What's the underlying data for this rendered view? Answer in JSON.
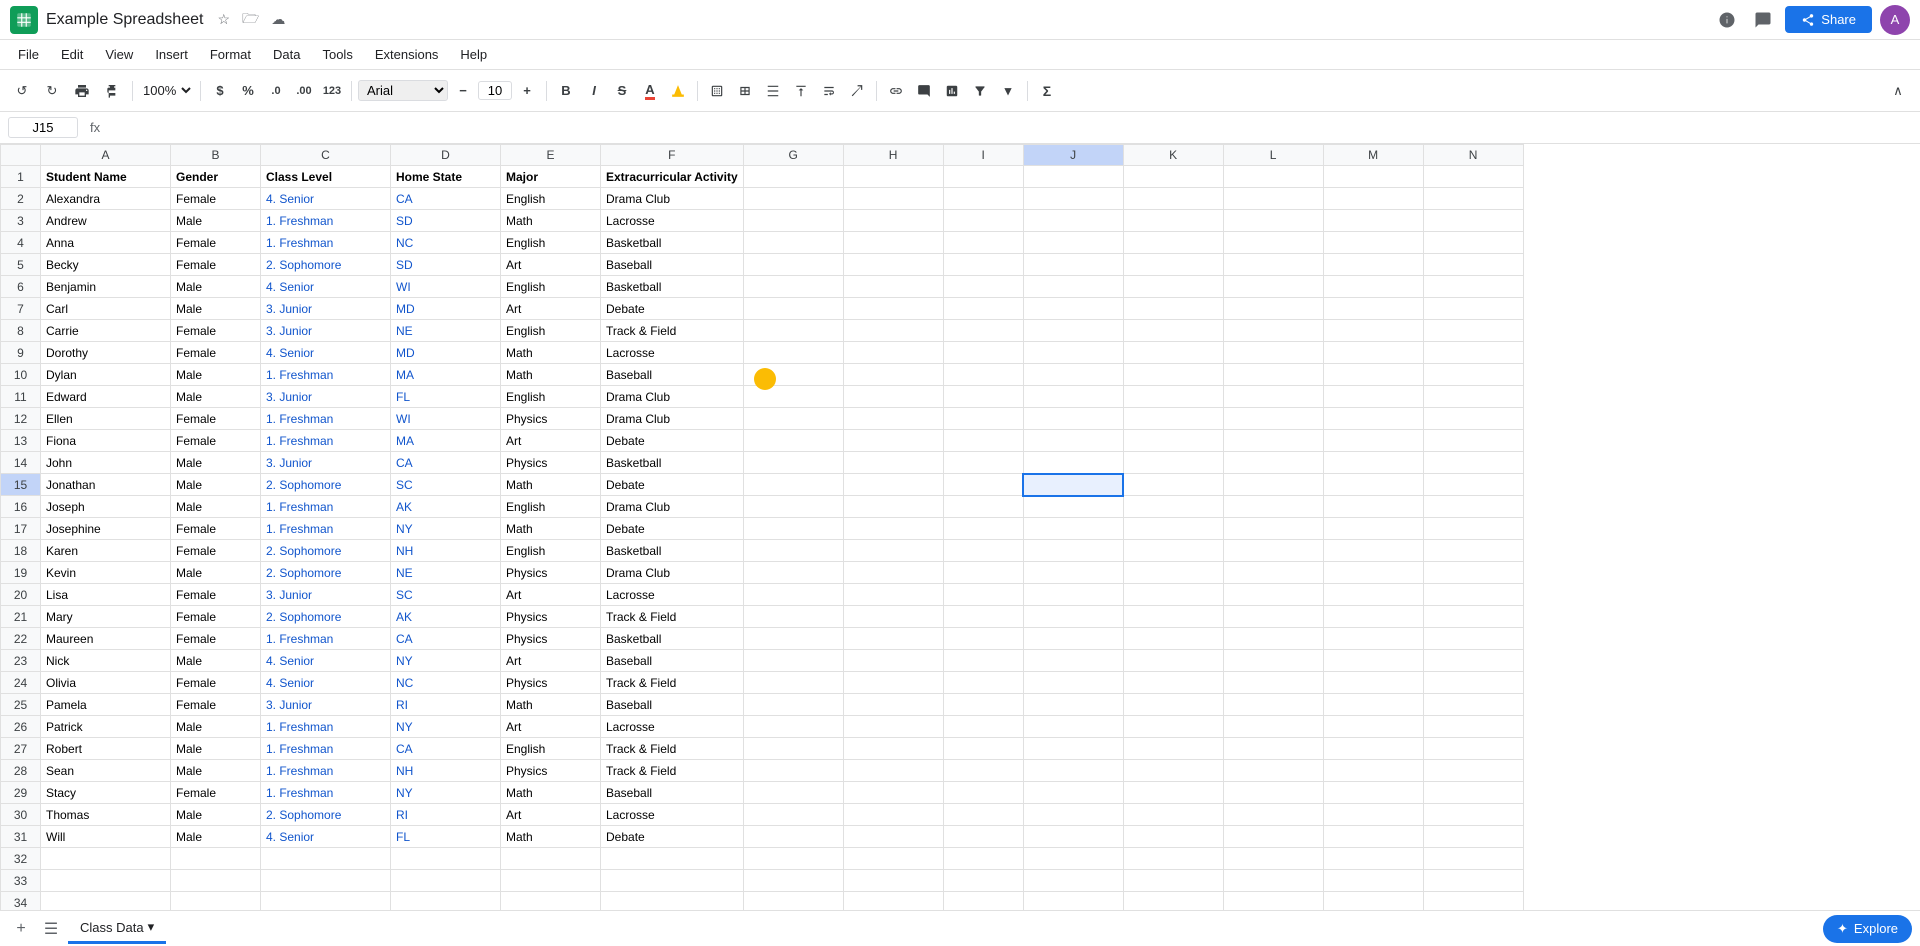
{
  "app": {
    "icon_color": "#0f9d58",
    "title": "Example Spreadsheet",
    "star_icon": "☆",
    "folder_icon": "🗁",
    "cloud_icon": "☁"
  },
  "menu": {
    "items": [
      "File",
      "Edit",
      "View",
      "Insert",
      "Format",
      "Data",
      "Tools",
      "Extensions",
      "Help"
    ]
  },
  "toolbar": {
    "undo_label": "↺",
    "redo_label": "↻",
    "print_label": "🖨",
    "paint_label": "🖌",
    "zoom": "100%",
    "currency_label": "$",
    "percent_label": "%",
    "dec1_label": ".0",
    "dec2_label": ".00",
    "num123_label": "123",
    "font_name": "Arial",
    "font_minus": "−",
    "font_size": "10",
    "font_plus": "+",
    "bold_label": "B",
    "italic_label": "I",
    "strike_label": "S̶",
    "color_label": "A"
  },
  "formula_bar": {
    "cell_ref": "J15",
    "fx": "fx"
  },
  "columns": {
    "headers": [
      "A",
      "B",
      "C",
      "D",
      "E",
      "F",
      "G",
      "H",
      "I",
      "J",
      "K",
      "L",
      "M",
      "N"
    ]
  },
  "rows": [
    {
      "row": 1,
      "cells": [
        "Student Name",
        "Gender",
        "Class Level",
        "Home State",
        "Major",
        "Extracurricular Activity",
        "",
        "",
        "",
        "",
        "",
        "",
        "",
        ""
      ]
    },
    {
      "row": 2,
      "cells": [
        "Alexandra",
        "Female",
        "4. Senior",
        "CA",
        "English",
        "Drama Club",
        "",
        "",
        "",
        "",
        "",
        "",
        "",
        ""
      ]
    },
    {
      "row": 3,
      "cells": [
        "Andrew",
        "Male",
        "1. Freshman",
        "SD",
        "Math",
        "Lacrosse",
        "",
        "",
        "",
        "",
        "",
        "",
        "",
        ""
      ]
    },
    {
      "row": 4,
      "cells": [
        "Anna",
        "Female",
        "1. Freshman",
        "NC",
        "English",
        "Basketball",
        "",
        "",
        "",
        "",
        "",
        "",
        "",
        ""
      ]
    },
    {
      "row": 5,
      "cells": [
        "Becky",
        "Female",
        "2. Sophomore",
        "SD",
        "Art",
        "Baseball",
        "",
        "",
        "",
        "",
        "",
        "",
        "",
        ""
      ]
    },
    {
      "row": 6,
      "cells": [
        "Benjamin",
        "Male",
        "4. Senior",
        "WI",
        "English",
        "Basketball",
        "",
        "",
        "",
        "",
        "",
        "",
        "",
        ""
      ]
    },
    {
      "row": 7,
      "cells": [
        "Carl",
        "Male",
        "3. Junior",
        "MD",
        "Art",
        "Debate",
        "",
        "",
        "",
        "",
        "",
        "",
        "",
        ""
      ]
    },
    {
      "row": 8,
      "cells": [
        "Carrie",
        "Female",
        "3. Junior",
        "NE",
        "English",
        "Track & Field",
        "",
        "",
        "",
        "",
        "",
        "",
        "",
        ""
      ]
    },
    {
      "row": 9,
      "cells": [
        "Dorothy",
        "Female",
        "4. Senior",
        "MD",
        "Math",
        "Lacrosse",
        "",
        "",
        "",
        "",
        "",
        "",
        "",
        ""
      ]
    },
    {
      "row": 10,
      "cells": [
        "Dylan",
        "Male",
        "1. Freshman",
        "MA",
        "Math",
        "Baseball",
        "",
        "",
        "",
        "",
        "",
        "",
        "",
        ""
      ]
    },
    {
      "row": 11,
      "cells": [
        "Edward",
        "Male",
        "3. Junior",
        "FL",
        "English",
        "Drama Club",
        "",
        "",
        "",
        "",
        "",
        "",
        "",
        ""
      ]
    },
    {
      "row": 12,
      "cells": [
        "Ellen",
        "Female",
        "1. Freshman",
        "WI",
        "Physics",
        "Drama Club",
        "",
        "",
        "",
        "",
        "",
        "",
        "",
        ""
      ]
    },
    {
      "row": 13,
      "cells": [
        "Fiona",
        "Female",
        "1. Freshman",
        "MA",
        "Art",
        "Debate",
        "",
        "",
        "",
        "",
        "",
        "",
        "",
        ""
      ]
    },
    {
      "row": 14,
      "cells": [
        "John",
        "Male",
        "3. Junior",
        "CA",
        "Physics",
        "Basketball",
        "",
        "",
        "",
        "",
        "",
        "",
        "",
        ""
      ]
    },
    {
      "row": 15,
      "cells": [
        "Jonathan",
        "Male",
        "2. Sophomore",
        "SC",
        "Math",
        "Debate",
        "",
        "",
        "",
        "",
        "",
        "",
        "",
        ""
      ]
    },
    {
      "row": 16,
      "cells": [
        "Joseph",
        "Male",
        "1. Freshman",
        "AK",
        "English",
        "Drama Club",
        "",
        "",
        "",
        "",
        "",
        "",
        "",
        ""
      ]
    },
    {
      "row": 17,
      "cells": [
        "Josephine",
        "Female",
        "1. Freshman",
        "NY",
        "Math",
        "Debate",
        "",
        "",
        "",
        "",
        "",
        "",
        "",
        ""
      ]
    },
    {
      "row": 18,
      "cells": [
        "Karen",
        "Female",
        "2. Sophomore",
        "NH",
        "English",
        "Basketball",
        "",
        "",
        "",
        "",
        "",
        "",
        "",
        ""
      ]
    },
    {
      "row": 19,
      "cells": [
        "Kevin",
        "Male",
        "2. Sophomore",
        "NE",
        "Physics",
        "Drama Club",
        "",
        "",
        "",
        "",
        "",
        "",
        "",
        ""
      ]
    },
    {
      "row": 20,
      "cells": [
        "Lisa",
        "Female",
        "3. Junior",
        "SC",
        "Art",
        "Lacrosse",
        "",
        "",
        "",
        "",
        "",
        "",
        "",
        ""
      ]
    },
    {
      "row": 21,
      "cells": [
        "Mary",
        "Female",
        "2. Sophomore",
        "AK",
        "Physics",
        "Track & Field",
        "",
        "",
        "",
        "",
        "",
        "",
        "",
        ""
      ]
    },
    {
      "row": 22,
      "cells": [
        "Maureen",
        "Female",
        "1. Freshman",
        "CA",
        "Physics",
        "Basketball",
        "",
        "",
        "",
        "",
        "",
        "",
        "",
        ""
      ]
    },
    {
      "row": 23,
      "cells": [
        "Nick",
        "Male",
        "4. Senior",
        "NY",
        "Art",
        "Baseball",
        "",
        "",
        "",
        "",
        "",
        "",
        "",
        ""
      ]
    },
    {
      "row": 24,
      "cells": [
        "Olivia",
        "Female",
        "4. Senior",
        "NC",
        "Physics",
        "Track & Field",
        "",
        "",
        "",
        "",
        "",
        "",
        "",
        ""
      ]
    },
    {
      "row": 25,
      "cells": [
        "Pamela",
        "Female",
        "3. Junior",
        "RI",
        "Math",
        "Baseball",
        "",
        "",
        "",
        "",
        "",
        "",
        "",
        ""
      ]
    },
    {
      "row": 26,
      "cells": [
        "Patrick",
        "Male",
        "1. Freshman",
        "NY",
        "Art",
        "Lacrosse",
        "",
        "",
        "",
        "",
        "",
        "",
        "",
        ""
      ]
    },
    {
      "row": 27,
      "cells": [
        "Robert",
        "Male",
        "1. Freshman",
        "CA",
        "English",
        "Track & Field",
        "",
        "",
        "",
        "",
        "",
        "",
        "",
        ""
      ]
    },
    {
      "row": 28,
      "cells": [
        "Sean",
        "Male",
        "1. Freshman",
        "NH",
        "Physics",
        "Track & Field",
        "",
        "",
        "",
        "",
        "",
        "",
        "",
        ""
      ]
    },
    {
      "row": 29,
      "cells": [
        "Stacy",
        "Female",
        "1. Freshman",
        "NY",
        "Math",
        "Baseball",
        "",
        "",
        "",
        "",
        "",
        "",
        "",
        ""
      ]
    },
    {
      "row": 30,
      "cells": [
        "Thomas",
        "Male",
        "2. Sophomore",
        "RI",
        "Art",
        "Lacrosse",
        "",
        "",
        "",
        "",
        "",
        "",
        "",
        ""
      ]
    },
    {
      "row": 31,
      "cells": [
        "Will",
        "Male",
        "4. Senior",
        "FL",
        "Math",
        "Debate",
        "",
        "",
        "",
        "",
        "",
        "",
        "",
        ""
      ]
    },
    {
      "row": 32,
      "cells": [
        "",
        "",
        "",
        "",
        "",
        "",
        "",
        "",
        "",
        "",
        "",
        "",
        "",
        ""
      ]
    },
    {
      "row": 33,
      "cells": [
        "",
        "",
        "",
        "",
        "",
        "",
        "",
        "",
        "",
        "",
        "",
        "",
        "",
        ""
      ]
    },
    {
      "row": 34,
      "cells": [
        "",
        "",
        "",
        "",
        "",
        "",
        "",
        "",
        "",
        "",
        "",
        "",
        "",
        ""
      ]
    }
  ],
  "tabs": {
    "active": "Class Data",
    "add_label": "+",
    "menu_label": "☰",
    "dropdown_label": "▾"
  },
  "explore": {
    "label": "Explore",
    "icon": "✦"
  },
  "selected_cell": {
    "row": 15,
    "col": 9
  }
}
